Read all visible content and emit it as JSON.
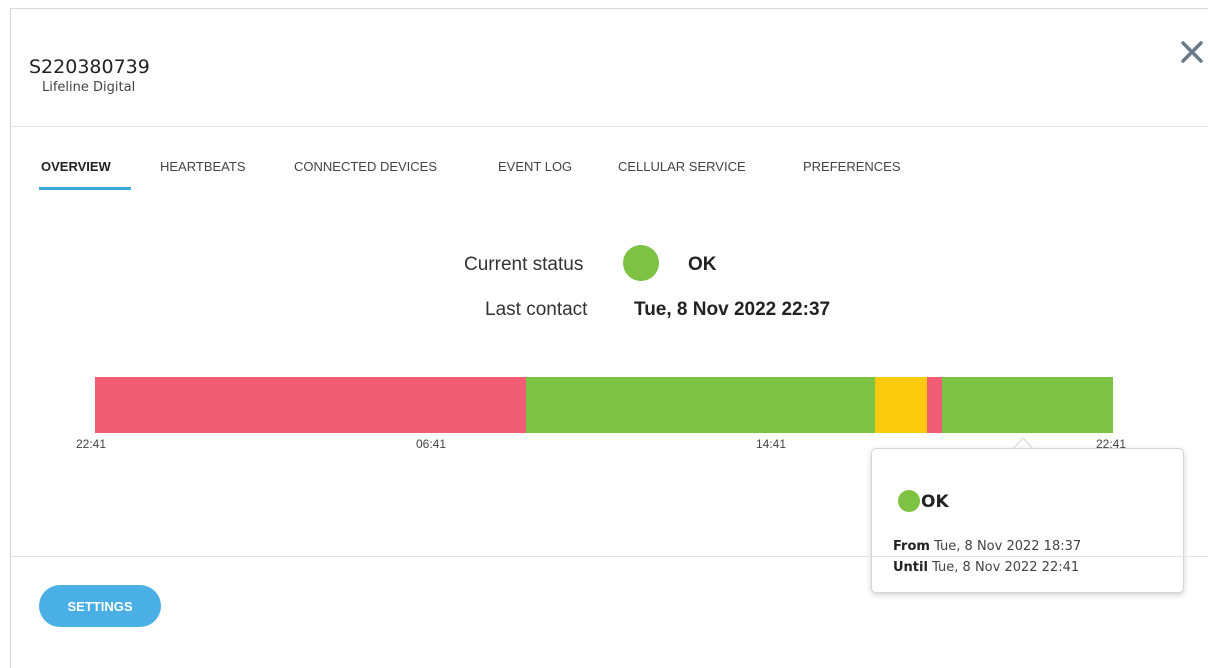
{
  "header": {
    "device_id": "S220380739",
    "device_type": "Lifeline Digital",
    "close_icon": "close-icon"
  },
  "tabs": [
    {
      "label": "OVERVIEW",
      "active": true
    },
    {
      "label": "HEARTBEATS",
      "active": false
    },
    {
      "label": "CONNECTED DEVICES",
      "active": false
    },
    {
      "label": "EVENT LOG",
      "active": false
    },
    {
      "label": "CELLULAR SERVICE",
      "active": false
    },
    {
      "label": "PREFERENCES",
      "active": false
    }
  ],
  "overview": {
    "status_label": "Current status",
    "status_value": "OK",
    "status_color": "#7dc243",
    "last_contact_label": "Last contact",
    "last_contact_value": "Tue, 8 Nov 2022 22:37"
  },
  "timeline": {
    "ticks": [
      "22:41",
      "06:41",
      "14:41",
      "22:41"
    ],
    "segments": [
      {
        "status": "error",
        "color": "#f05d74",
        "fraction": 0.4234
      },
      {
        "status": "ok",
        "color": "#7dc243",
        "fraction": 0.3428
      },
      {
        "status": "warning",
        "color": "#fbca0c",
        "fraction": 0.0511
      },
      {
        "status": "error",
        "color": "#f05d74",
        "fraction": 0.0147
      },
      {
        "status": "ok",
        "color": "#7dc243",
        "fraction": 0.168
      }
    ]
  },
  "tooltip": {
    "status": "OK",
    "from_label": "From",
    "from_value": "Tue, 8 Nov 2022 18:37",
    "until_label": "Until",
    "until_value": "Tue, 8 Nov 2022 22:41"
  },
  "footer": {
    "settings_label": "SETTINGS"
  },
  "colors": {
    "accent": "#3aa7dd",
    "button": "#4aafe5",
    "ok": "#7dc243",
    "warning": "#fbca0c",
    "error": "#f05d74"
  }
}
